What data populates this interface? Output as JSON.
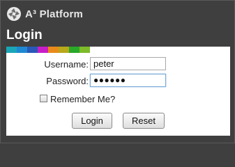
{
  "header": {
    "brand": "A³ Platform",
    "logo_icon": "aperture-logo-icon",
    "title": "Login"
  },
  "accent_strip": [
    "#1aa6b7",
    "#1e88d2",
    "#2a58b8",
    "#c81ec8",
    "#e88a1a",
    "#b8a81a",
    "#2aa82a",
    "#7dbb2a"
  ],
  "form": {
    "username_label": "Username:",
    "username_value": "peter",
    "password_label": "Password:",
    "password_value": "●●●●●●",
    "remember_label": "Remember Me?",
    "remember_checked": false,
    "login_button": "Login",
    "reset_button": "Reset"
  }
}
